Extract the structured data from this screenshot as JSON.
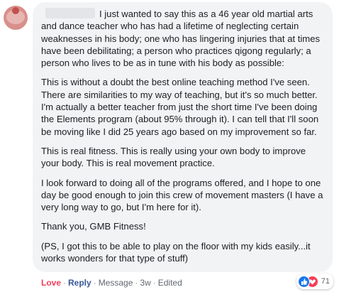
{
  "comment": {
    "paragraphs": [
      "I just wanted to say this as a 46 year old martial arts and dance teacher who has had a lifetime of neglecting certain weaknesses in his body; one who has lingering injuries that at times have been debilitating; a person who practices qigong regularly; a person who lives to be as in tune with his body as possible:",
      "This is without a doubt the best online teaching method I've seen. There are similarities to my way of teaching, but it's so much better. I'm actually a better teacher from just the short time I've been doing the Elements program (about 95% through it). I can tell that I'll soon be moving like I did 25 years ago based on my improvement so far.",
      "This is real fitness. This is really using your own body to improve your body. This is real movement practice.",
      "I look forward to doing all of the programs offered, and I hope to one day be good enough to join this crew of movement masters (I have a very long way to go, but I'm here for it).",
      "Thank you, GMB Fitness!",
      "(PS, I got this to be able to play on the floor with my kids easily...it works wonders for that type of stuff)"
    ]
  },
  "reactions": {
    "icons": [
      "like-icon",
      "love-icon"
    ],
    "count": "71"
  },
  "actions": {
    "love": "Love",
    "reply": "Reply",
    "message": "Message",
    "time": "3w",
    "edited": "Edited",
    "separator": "·"
  },
  "colors": {
    "bubble": "#f2f3f5",
    "love": "#f33e58",
    "reply": "#385898",
    "like": "#1877f2",
    "meta": "#606770"
  }
}
